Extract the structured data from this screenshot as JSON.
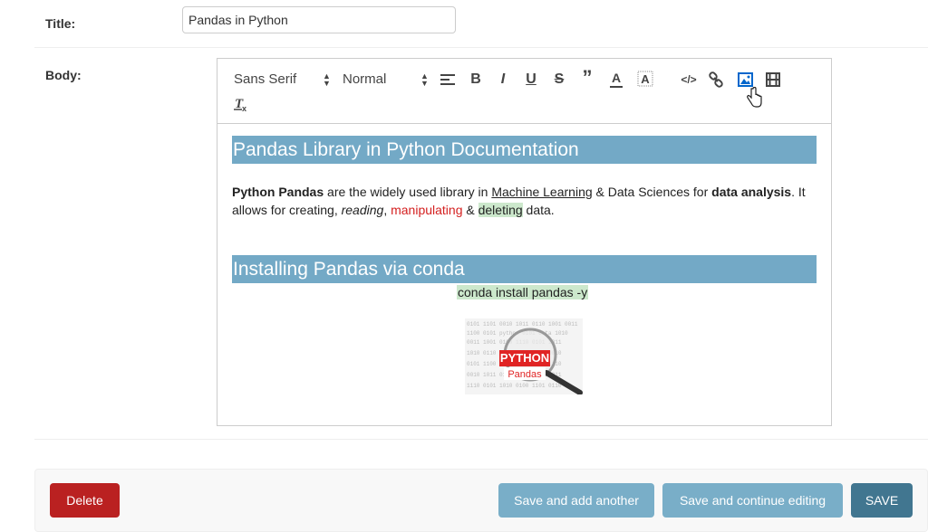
{
  "form": {
    "title_label": "Title:",
    "title_value": "Pandas in Python",
    "body_label": "Body:"
  },
  "toolbar": {
    "font_select": "Sans Serif",
    "size_select": "Normal",
    "icons": [
      "align-icon",
      "bold-icon",
      "italic-icon",
      "underline-icon",
      "strike-icon",
      "blockquote-icon",
      "text-color-icon",
      "background-color-icon",
      "code-block-icon",
      "link-icon",
      "image-icon",
      "video-icon",
      "clean-format-icon"
    ]
  },
  "content": {
    "heading1": "Pandas Library in Python Documentation",
    "para": {
      "bold1": "Python Pandas",
      "t1": " are the widely used library in ",
      "link": "Machine Learning",
      "t2": " & Data Sciences for ",
      "bold2": "data analysis",
      "t3": ". It allows for creating, ",
      "italic": "reading",
      "t4": ", ",
      "red": "manipulating",
      "t5": " & ",
      "green": "deleting",
      "t6": " data."
    },
    "heading2": "Installing Pandas via conda",
    "code": "conda install pandas -y",
    "image": {
      "word1": "PYTHON",
      "word2": "Pandas"
    }
  },
  "buttons": {
    "delete": "Delete",
    "save_add": "Save and add another",
    "save_continue": "Save and continue editing",
    "save": "SAVE"
  },
  "colors": {
    "heading_bg": "#73a9c6",
    "delete": "#ba2121",
    "secondary": "#79aec8",
    "primary": "#417690",
    "red_text": "#d42020",
    "green_highlight": "#cce8cc"
  }
}
